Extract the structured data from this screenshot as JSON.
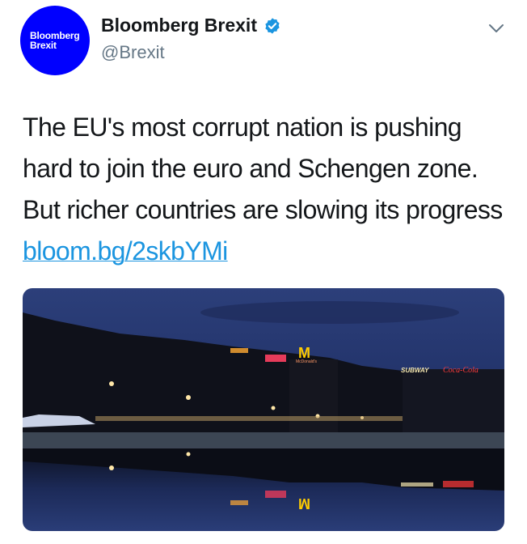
{
  "author": {
    "avatar_line1": "Bloomberg",
    "avatar_line2": "Brexit",
    "display_name": "Bloomberg Brexit",
    "handle": "@Brexit",
    "verified_icon": "verified-badge-icon",
    "brand_color": "#0000ff"
  },
  "menu": {
    "icon": "chevron-down-icon"
  },
  "tweet": {
    "text": "The EU's most corrupt nation is pushing hard to join the euro and Schengen zone. But richer countries are slowing its progress ",
    "link": "bloom.bg/2skbYMi",
    "link_color": "#1b95e0"
  },
  "photo": {
    "subject": "night-city-square-reflection",
    "signs": {
      "mcdonalds": "McDonald's",
      "subway": "SUBWAY",
      "cocacola": "Coca-Cola"
    }
  }
}
